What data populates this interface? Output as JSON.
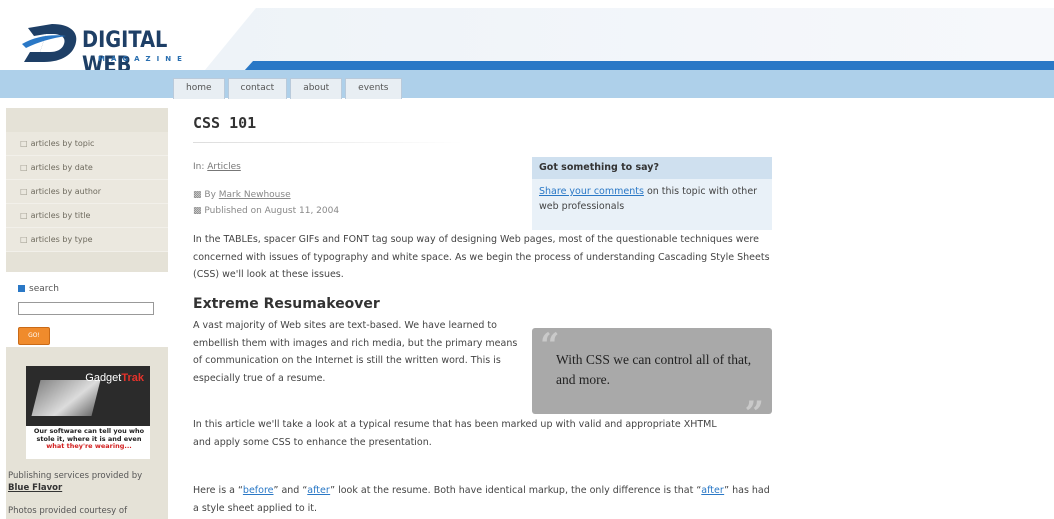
{
  "brand": {
    "name": "DIGITAL WEB",
    "sub": "MAGAZINE",
    "logo_letter": "D",
    "colors": {
      "dark": "#1e3f66",
      "blue": "#2a78c6",
      "light_blue": "#aed0ea",
      "orange": "#f08b2c"
    }
  },
  "tabs": [
    {
      "label": "home"
    },
    {
      "label": "contact"
    },
    {
      "label": "about"
    },
    {
      "label": "events"
    }
  ],
  "sidebar": {
    "items": [
      {
        "label": "articles by topic"
      },
      {
        "label": "articles by date"
      },
      {
        "label": "articles by author"
      },
      {
        "label": "articles by title"
      },
      {
        "label": "articles by type"
      }
    ],
    "search_label": "search",
    "search_value": "",
    "go_label": "GO!",
    "ad": {
      "brand_a": "Gadget",
      "brand_b": "Trak",
      "text_a": "Our software can tell you who stole it, where it is and even",
      "text_b": "what they're wearing..."
    },
    "credits_text": "Publishing services provided by",
    "credits_link": "Blue Flavor",
    "photos_text": "Photos provided courtesy of"
  },
  "article": {
    "title": "CSS 101",
    "in_prefix": "In:",
    "in_link": "Articles",
    "by_prefix": "By",
    "author": "Mark Newhouse",
    "published": "Published on August 11, 2004",
    "comment_box": {
      "heading": "Got something to say?",
      "link": "Share your comments",
      "text": "on this topic with other web professionals"
    },
    "intro": "In the TABLEs, spacer GIFs and FONT tag soup way of designing Web pages, most of the questionable techniques were concerned with issues of typography and white space. As we begin the process of understanding Cascading Style Sheets (CSS) we'll look at these issues.",
    "section_heading": "Extreme Resumakeover",
    "para1": "A vast majority of Web sites are text-based. We have learned to embellish them with images and rich media, but the primary means of communication on the Internet is still the written word. This is especially true of a resume.",
    "pullquote": "With CSS we can control all of that, and more.",
    "para2": "In this article we'll take a look at a typical resume that has been marked up with valid and appropriate XHTML and apply some CSS to enhance the presentation.",
    "para3_a": "Here is a “",
    "before_link": "before",
    "para3_b": "” and “",
    "after_link": "after",
    "para3_c": "” look at the resume. Both have identical markup, the only difference is that “",
    "after_link2": "after",
    "para3_d": "” has had a style sheet applied to it."
  }
}
